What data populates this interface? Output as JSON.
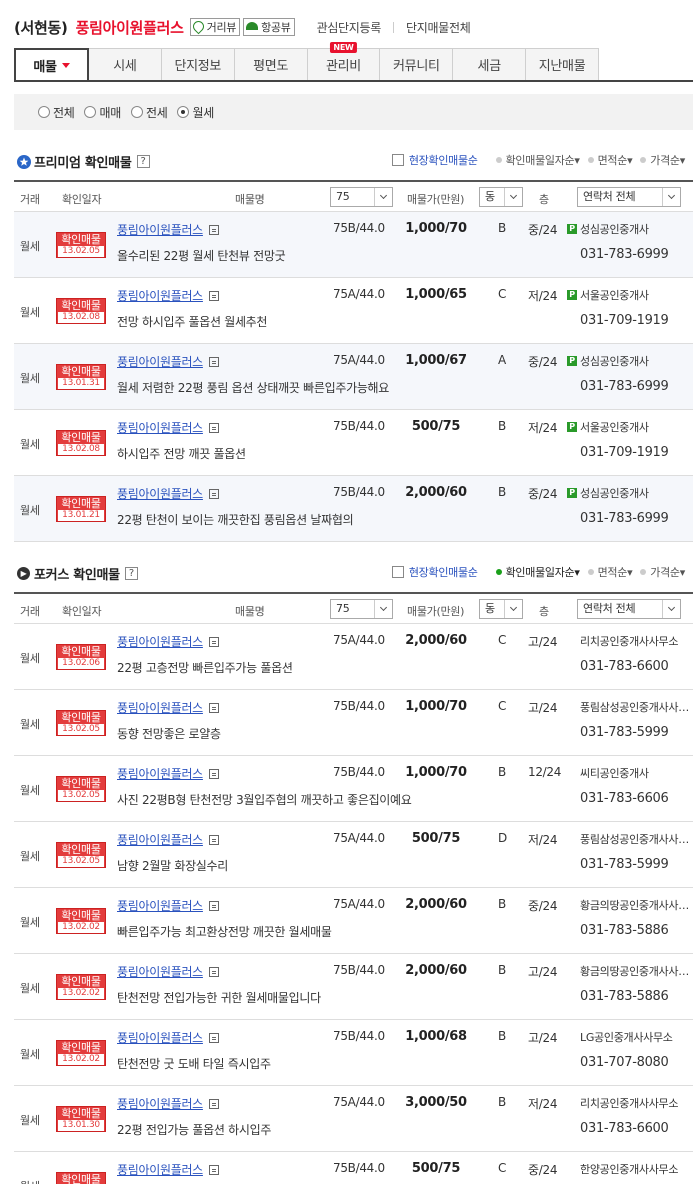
{
  "header": {
    "location": "(서현동)",
    "complex_name": "풍림아이원플러스",
    "street_view_label": "거리뷰",
    "aerial_view_label": "항공뷰",
    "register_link": "관심단지등록",
    "all_listings_link": "단지매물전체"
  },
  "tabs": [
    {
      "label": "매물"
    },
    {
      "label": "시세"
    },
    {
      "label": "단지정보"
    },
    {
      "label": "평면도"
    },
    {
      "label": "관리비",
      "badge": "NEW"
    },
    {
      "label": "커뮤니티"
    },
    {
      "label": "세금"
    },
    {
      "label": "지난매물"
    }
  ],
  "filter": {
    "options": [
      "전체",
      "매매",
      "전세",
      "월세"
    ],
    "selected": "월세"
  },
  "columns": {
    "type": "거래",
    "date": "확인일자",
    "name": "매물명",
    "area_select": "75",
    "price": "매물가(만원)",
    "dong_select": "동",
    "floor": "층",
    "agent_select": "연락처 전체"
  },
  "stamp_label": "확인매물",
  "premium": {
    "title": "프리미엄 확인매물",
    "help": "?",
    "onsite_label": "현장확인매물순",
    "sort_date": "확인매물일자순",
    "sort_area": "면적순",
    "sort_price": "가격순",
    "rows": [
      {
        "type": "월세",
        "date": "13.02.05",
        "name": "풍림아이원플러스",
        "desc": "올수리된 22평 월세 탄천뷰 전망굿",
        "area": "75B/44.0",
        "price": "1,000/70",
        "dir": "B",
        "floor": "중/24",
        "agent": "성심공인중개사",
        "phone": "031-783-6999"
      },
      {
        "type": "월세",
        "date": "13.02.08",
        "name": "풍림아이원플러스",
        "desc": "전망 하시입주 풀옵션 월세추천",
        "area": "75A/44.0",
        "price": "1,000/65",
        "dir": "C",
        "floor": "저/24",
        "agent": "서울공인중개사",
        "phone": "031-709-1919"
      },
      {
        "type": "월세",
        "date": "13.01.31",
        "name": "풍림아이원플러스",
        "desc": "월세 저렴한 22평 풍림 옵션 상태깨끗 빠른입주가능해요",
        "area": "75A/44.0",
        "price": "1,000/67",
        "dir": "A",
        "floor": "중/24",
        "agent": "성심공인중개사",
        "phone": "031-783-6999"
      },
      {
        "type": "월세",
        "date": "13.02.08",
        "name": "풍림아이원플러스",
        "desc": "하시입주 전망 깨끗 풀옵션",
        "area": "75B/44.0",
        "price": "500/75",
        "dir": "B",
        "floor": "저/24",
        "agent": "서울공인중개사",
        "phone": "031-709-1919"
      },
      {
        "type": "월세",
        "date": "13.01.21",
        "name": "풍림아이원플러스",
        "desc": "22평 탄천이 보이는 깨끗한집 풍림옵션 날짜협의",
        "area": "75B/44.0",
        "price": "2,000/60",
        "dir": "B",
        "floor": "중/24",
        "agent": "성심공인중개사",
        "phone": "031-783-6999"
      }
    ]
  },
  "focus": {
    "title": "포커스 확인매물",
    "help": "?",
    "onsite_label": "현장확인매물순",
    "sort_date": "확인매물일자순",
    "sort_area": "면적순",
    "sort_price": "가격순",
    "rows": [
      {
        "type": "월세",
        "date": "13.02.06",
        "name": "풍림아이원플러스",
        "desc": "22평 고층전망 빠른입주가능 풀옵션",
        "area": "75A/44.0",
        "price": "2,000/60",
        "dir": "C",
        "floor": "고/24",
        "agent": "리치공인중개사사무소",
        "phone": "031-783-6600"
      },
      {
        "type": "월세",
        "date": "13.02.05",
        "name": "풍림아이원플러스",
        "desc": "동향 전망좋은 로얄층",
        "area": "75B/44.0",
        "price": "1,000/70",
        "dir": "C",
        "floor": "고/24",
        "agent": "풍림삼성공인중개사사무소",
        "phone": "031-783-5999"
      },
      {
        "type": "월세",
        "date": "13.02.05",
        "name": "풍림아이원플러스",
        "desc": "사진 22평B형 탄천전망 3월입주협의 깨끗하고 좋은집이예요",
        "area": "75B/44.0",
        "price": "1,000/70",
        "dir": "B",
        "floor": "12/24",
        "agent": "씨티공인중개사",
        "phone": "031-783-6606"
      },
      {
        "type": "월세",
        "date": "13.02.05",
        "name": "풍림아이원플러스",
        "desc": "남향 2월말 화장실수리",
        "area": "75A/44.0",
        "price": "500/75",
        "dir": "D",
        "floor": "저/24",
        "agent": "풍림삼성공인중개사사무소",
        "phone": "031-783-5999"
      },
      {
        "type": "월세",
        "date": "13.02.02",
        "name": "풍림아이원플러스",
        "desc": "빠른입주가능 최고환상전망 깨끗한 월세매물",
        "area": "75A/44.0",
        "price": "2,000/60",
        "dir": "B",
        "floor": "중/24",
        "agent": "황금의땅공인중개사사무소",
        "phone": "031-783-5886"
      },
      {
        "type": "월세",
        "date": "13.02.02",
        "name": "풍림아이원플러스",
        "desc": "탄천전망 전입가능한 귀한 월세매물입니다",
        "area": "75B/44.0",
        "price": "2,000/60",
        "dir": "B",
        "floor": "고/24",
        "agent": "황금의땅공인중개사사무소",
        "phone": "031-783-5886"
      },
      {
        "type": "월세",
        "date": "13.02.02",
        "name": "풍림아이원플러스",
        "desc": "탄천전망 굿 도배 타일 즉시입주",
        "area": "75B/44.0",
        "price": "1,000/68",
        "dir": "B",
        "floor": "고/24",
        "agent": "LG공인중개사사무소",
        "phone": "031-707-8080"
      },
      {
        "type": "월세",
        "date": "13.01.30",
        "name": "풍림아이원플러스",
        "desc": "22평 전입가능 풀옵션 하시입주",
        "area": "75A/44.0",
        "price": "3,000/50",
        "dir": "B",
        "floor": "저/24",
        "agent": "리치공인중개사사무소",
        "phone": "031-783-6600"
      },
      {
        "type": "월세",
        "date": "",
        "name": "풍림아이원플러스",
        "desc": "",
        "area": "75B/44.0",
        "price": "500/75",
        "dir": "C",
        "floor": "중/24",
        "agent": "한양공인중개사사무소",
        "phone": ""
      }
    ]
  }
}
